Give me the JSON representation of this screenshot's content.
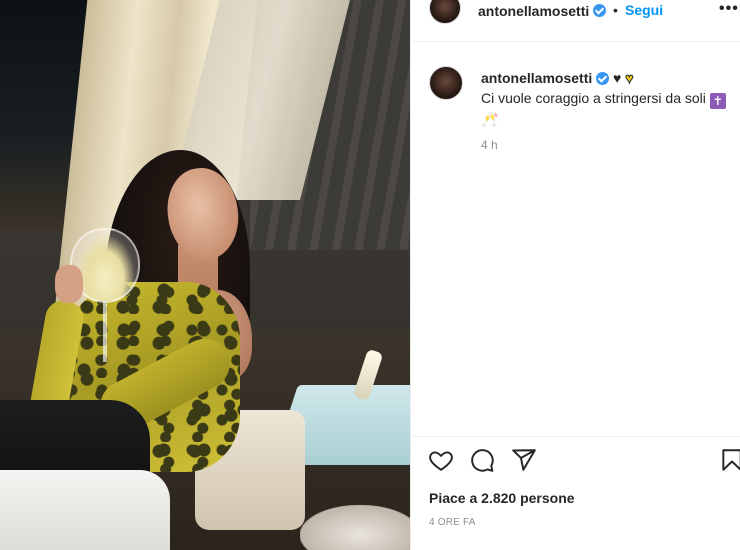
{
  "post": {
    "username": "antonellamosetti",
    "follow_label": "Segui",
    "separator": "•",
    "more_label": "•••"
  },
  "caption": {
    "username": "antonellamosetti",
    "text": "Ci vuole coraggio a stringersi da soli",
    "emoji_heart_black": "♥",
    "emoji_heart_yellow": "♥",
    "emoji_cross": "✝",
    "emoji_cheers": "🥂",
    "time": "4 h"
  },
  "actions": {
    "icons": [
      "heart-icon",
      "comment-icon",
      "share-icon",
      "bookmark-icon"
    ]
  },
  "likes_text": "Piace a 2.820 persone",
  "posted_time": "4 ORE FA",
  "colors": {
    "link": "#0095f6",
    "verified": "#3897f0",
    "muted": "#8e8e8e",
    "text": "#262626"
  }
}
